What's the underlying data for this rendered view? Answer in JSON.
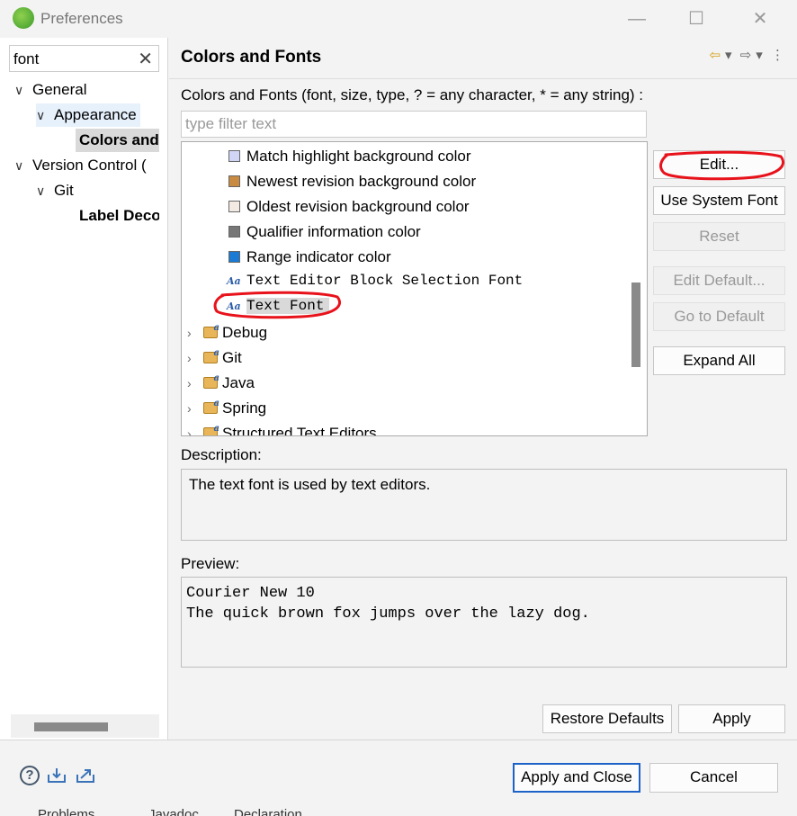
{
  "window": {
    "title": "Preferences",
    "minimize_glyph": "—",
    "maximize_glyph": "☐",
    "close_glyph": "✕"
  },
  "left": {
    "search_value": "font",
    "clear_glyph": "✕",
    "tree": [
      {
        "label": "General",
        "chevron": "∨"
      },
      {
        "label": "Appearance",
        "chevron": "∨"
      },
      {
        "label": "Colors and",
        "chevron": ""
      },
      {
        "label": "Version Control (",
        "chevron": "∨"
      },
      {
        "label": "Git",
        "chevron": "∨"
      },
      {
        "label": "Label Deco",
        "chevron": ""
      }
    ]
  },
  "page": {
    "title": "Colors and Fonts",
    "nav_back": "⇦",
    "nav_forward": "⇨",
    "nav_dropdown": "▾",
    "nav_menu": "⋮",
    "filter_label": "Colors and Fonts (font, size, type, ? = any character, * = any string) :",
    "filter_placeholder": "type filter text",
    "items": [
      {
        "label": "Match highlight background color",
        "swatch": "#d0d4f5"
      },
      {
        "label": "Newest revision background color",
        "swatch": "#c98a41"
      },
      {
        "label": "Oldest revision background color",
        "swatch": "#f3ebe3"
      },
      {
        "label": "Qualifier information color",
        "swatch": "#777777"
      },
      {
        "label": "Range indicator color",
        "swatch": "#1a7ad4"
      },
      {
        "label": "Text Editor Block Selection Font",
        "icon": "Aa"
      },
      {
        "label": "Text Font",
        "icon": "Aa"
      }
    ],
    "groups": [
      {
        "label": "Debug",
        "chevron": "›"
      },
      {
        "label": "Git",
        "chevron": "›"
      },
      {
        "label": "Java",
        "chevron": "›"
      },
      {
        "label": "Spring",
        "chevron": "›"
      },
      {
        "label": "Structured Text Editors",
        "chevron": "›"
      }
    ],
    "buttons": {
      "edit": "Edit...",
      "use_system_font": "Use System Font",
      "reset": "Reset",
      "edit_default": "Edit Default...",
      "go_to_default": "Go to Default",
      "expand_all": "Expand All"
    },
    "description_label": "Description:",
    "description_text": "The text font is used by text editors.",
    "preview_label": "Preview:",
    "preview_line1": "Courier New 10",
    "preview_line2": "The quick brown fox jumps over the lazy dog.",
    "restore_defaults": "Restore Defaults",
    "apply": "Apply"
  },
  "footer": {
    "help_glyph": "?",
    "apply_and_close": "Apply and Close",
    "cancel": "Cancel",
    "behind_tabs": [
      "Problems",
      "Javadoc",
      "Declaration"
    ]
  },
  "annotation_color": "#e8121b"
}
